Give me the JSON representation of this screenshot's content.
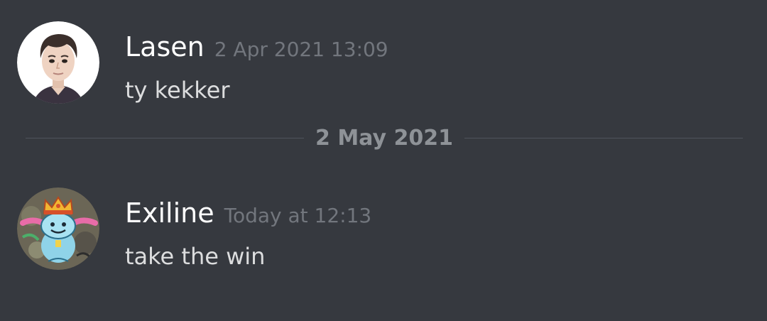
{
  "messages": [
    {
      "author": "Lasen",
      "timestamp": "2 Apr 2021 13:09",
      "content": "ty kekker",
      "avatar_icon": "person-avatar"
    },
    {
      "author": "Exiline",
      "timestamp": "Today at 12:13",
      "content": "take the win",
      "avatar_icon": "crowned-creature-avatar"
    }
  ],
  "date_divider": {
    "label": "2 May 2021"
  },
  "colors": {
    "background": "#36393f",
    "username": "#ffffff",
    "timestamp": "#72767d",
    "message_text": "#dcddde",
    "divider_text": "#8e9297",
    "divider_line": "#4f545c"
  }
}
